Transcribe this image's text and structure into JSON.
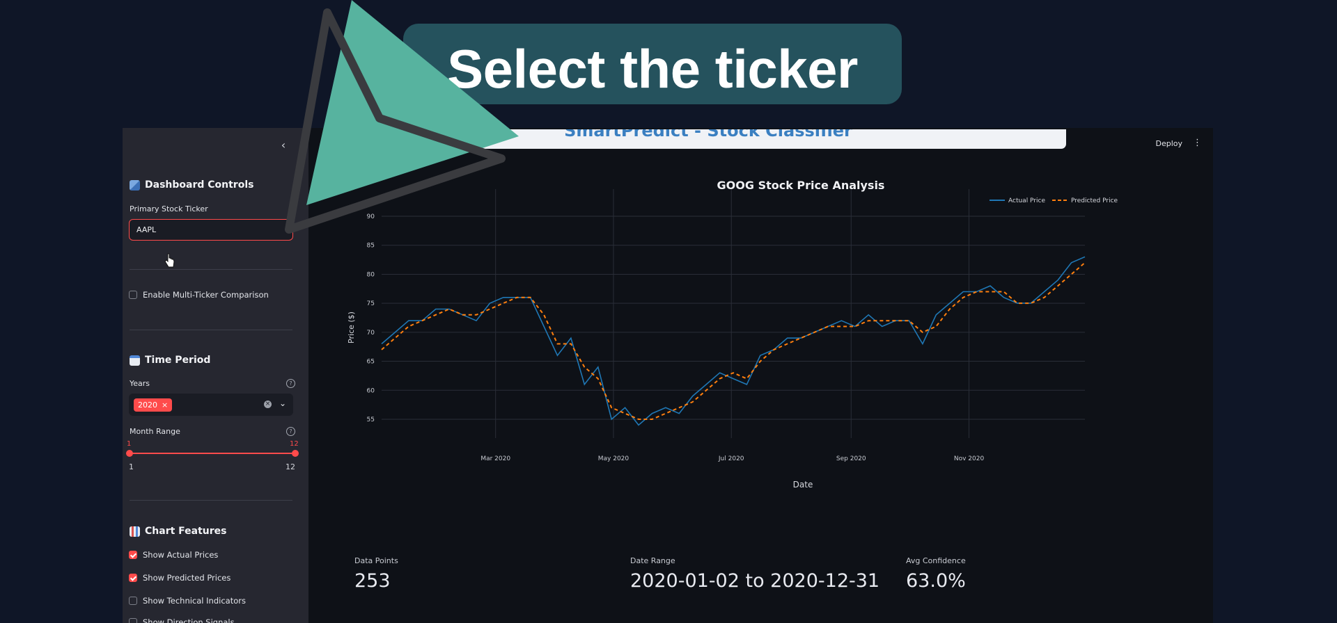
{
  "overlay": {
    "callout": "Select the ticker"
  },
  "sidebar": {
    "dashboard_title": "Dashboard Controls",
    "primary_ticker_label": "Primary Stock Ticker",
    "primary_ticker_value": "AAPL",
    "multi_ticker_label": "Enable Multi-Ticker Comparison",
    "multi_ticker_checked": false,
    "time_title": "Time Period",
    "years_label": "Years",
    "years_selected": "2020",
    "tag_remove": "×",
    "month_label": "Month Range",
    "month_low": "1",
    "month_high": "12",
    "month_min": "1",
    "month_max": "12",
    "chart_title": "Chart Features",
    "features": [
      {
        "label": "Show Actual Prices",
        "checked": true
      },
      {
        "label": "Show Predicted Prices",
        "checked": true
      },
      {
        "label": "Show Technical Indicators",
        "checked": false
      },
      {
        "label": "Show Direction Signals",
        "checked": false
      }
    ]
  },
  "header": {
    "title": "SmartPredict - Stock Classifier",
    "deploy": "Deploy"
  },
  "metrics": [
    {
      "label": "Data Points",
      "value": "253"
    },
    {
      "label": "Date Range",
      "value": "2020-01-02 to 2020-12-31"
    },
    {
      "label": "Avg Confidence",
      "value": "63.0%"
    }
  ],
  "colors": {
    "accent": "#ff4b4b",
    "actual": "#1f77b4",
    "predicted": "#ff7f0e",
    "callout": "#25525d",
    "pointer": "#57b39f"
  },
  "chart_data": {
    "type": "line",
    "title": "GOOG Stock Price Analysis",
    "xlabel": "Date",
    "ylabel": "Price ($)",
    "x_ticks": [
      "Mar 2020",
      "May 2020",
      "Jul 2020",
      "Sep 2020",
      "Nov 2020"
    ],
    "y_ticks": [
      55,
      60,
      65,
      70,
      75,
      80,
      85,
      90
    ],
    "ylim": [
      52,
      93
    ],
    "xlim": [
      "2020-01-02",
      "2020-12-31"
    ],
    "legend_position": "top-right",
    "grid": true,
    "series": [
      {
        "name": "Actual Price",
        "style": "solid",
        "points": [
          [
            "2020-01-02",
            68
          ],
          [
            "2020-01-09",
            70
          ],
          [
            "2020-01-16",
            72
          ],
          [
            "2020-01-23",
            72
          ],
          [
            "2020-01-30",
            74
          ],
          [
            "2020-02-06",
            74
          ],
          [
            "2020-02-13",
            73
          ],
          [
            "2020-02-20",
            72
          ],
          [
            "2020-02-27",
            75
          ],
          [
            "2020-03-05",
            76
          ],
          [
            "2020-03-12",
            76
          ],
          [
            "2020-03-19",
            76
          ],
          [
            "2020-03-26",
            71
          ],
          [
            "2020-04-02",
            66
          ],
          [
            "2020-04-09",
            69
          ],
          [
            "2020-04-16",
            61
          ],
          [
            "2020-04-23",
            64
          ],
          [
            "2020-04-30",
            55
          ],
          [
            "2020-05-07",
            57
          ],
          [
            "2020-05-14",
            54
          ],
          [
            "2020-05-21",
            56
          ],
          [
            "2020-05-28",
            57
          ],
          [
            "2020-06-04",
            56
          ],
          [
            "2020-06-11",
            59
          ],
          [
            "2020-06-18",
            61
          ],
          [
            "2020-06-25",
            63
          ],
          [
            "2020-07-02",
            62
          ],
          [
            "2020-07-09",
            61
          ],
          [
            "2020-07-16",
            66
          ],
          [
            "2020-07-23",
            67
          ],
          [
            "2020-07-30",
            69
          ],
          [
            "2020-08-06",
            69
          ],
          [
            "2020-08-13",
            70
          ],
          [
            "2020-08-20",
            71
          ],
          [
            "2020-08-27",
            72
          ],
          [
            "2020-09-03",
            71
          ],
          [
            "2020-09-10",
            73
          ],
          [
            "2020-09-17",
            71
          ],
          [
            "2020-09-24",
            72
          ],
          [
            "2020-10-01",
            72
          ],
          [
            "2020-10-08",
            68
          ],
          [
            "2020-10-15",
            73
          ],
          [
            "2020-10-22",
            75
          ],
          [
            "2020-10-29",
            77
          ],
          [
            "2020-11-05",
            77
          ],
          [
            "2020-11-12",
            78
          ],
          [
            "2020-11-19",
            76
          ],
          [
            "2020-11-26",
            75
          ],
          [
            "2020-12-03",
            75
          ],
          [
            "2020-12-10",
            77
          ],
          [
            "2020-12-17",
            79
          ],
          [
            "2020-12-24",
            82
          ],
          [
            "2020-12-31",
            83
          ]
        ]
      },
      {
        "name": "Predicted Price",
        "style": "dashed",
        "points": [
          [
            "2020-01-02",
            67
          ],
          [
            "2020-01-09",
            69
          ],
          [
            "2020-01-16",
            71
          ],
          [
            "2020-01-23",
            72
          ],
          [
            "2020-01-30",
            73
          ],
          [
            "2020-02-06",
            74
          ],
          [
            "2020-02-13",
            73
          ],
          [
            "2020-02-20",
            73
          ],
          [
            "2020-02-27",
            74
          ],
          [
            "2020-03-05",
            75
          ],
          [
            "2020-03-12",
            76
          ],
          [
            "2020-03-19",
            76
          ],
          [
            "2020-03-26",
            73
          ],
          [
            "2020-04-02",
            68
          ],
          [
            "2020-04-09",
            68
          ],
          [
            "2020-04-16",
            64
          ],
          [
            "2020-04-23",
            62
          ],
          [
            "2020-04-30",
            57
          ],
          [
            "2020-05-07",
            56
          ],
          [
            "2020-05-14",
            55
          ],
          [
            "2020-05-21",
            55
          ],
          [
            "2020-05-28",
            56
          ],
          [
            "2020-06-04",
            57
          ],
          [
            "2020-06-11",
            58
          ],
          [
            "2020-06-18",
            60
          ],
          [
            "2020-06-25",
            62
          ],
          [
            "2020-07-02",
            63
          ],
          [
            "2020-07-09",
            62
          ],
          [
            "2020-07-16",
            65
          ],
          [
            "2020-07-23",
            67
          ],
          [
            "2020-07-30",
            68
          ],
          [
            "2020-08-06",
            69
          ],
          [
            "2020-08-13",
            70
          ],
          [
            "2020-08-20",
            71
          ],
          [
            "2020-08-27",
            71
          ],
          [
            "2020-09-03",
            71
          ],
          [
            "2020-09-10",
            72
          ],
          [
            "2020-09-17",
            72
          ],
          [
            "2020-09-24",
            72
          ],
          [
            "2020-10-01",
            72
          ],
          [
            "2020-10-08",
            70
          ],
          [
            "2020-10-15",
            71
          ],
          [
            "2020-10-22",
            74
          ],
          [
            "2020-10-29",
            76
          ],
          [
            "2020-11-05",
            77
          ],
          [
            "2020-11-12",
            77
          ],
          [
            "2020-11-19",
            77
          ],
          [
            "2020-11-26",
            75
          ],
          [
            "2020-12-03",
            75
          ],
          [
            "2020-12-10",
            76
          ],
          [
            "2020-12-17",
            78
          ],
          [
            "2020-12-24",
            80
          ],
          [
            "2020-12-31",
            82
          ]
        ]
      }
    ]
  }
}
